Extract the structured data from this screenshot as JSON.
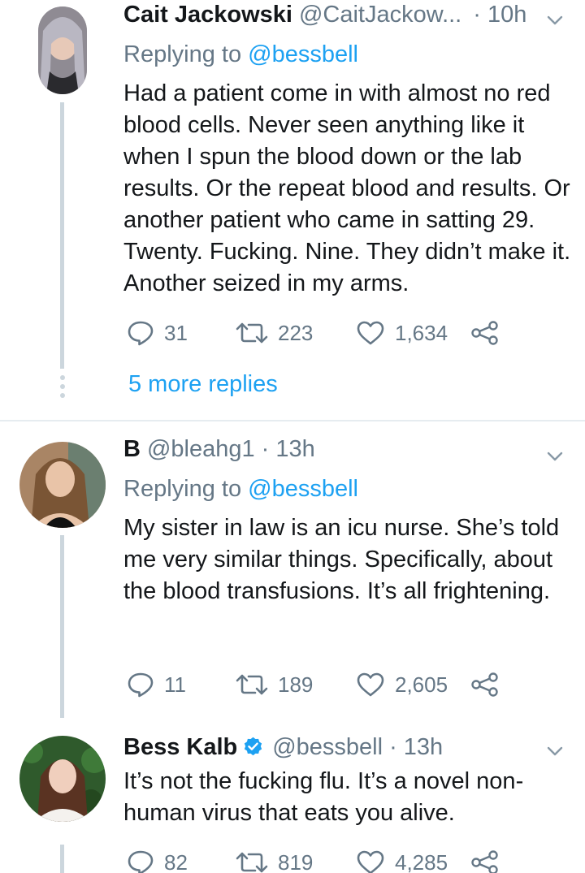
{
  "colors": {
    "accent": "#1da1f2",
    "muted": "#657786",
    "text": "#14171a",
    "line": "#ccd6dd"
  },
  "tweets": [
    {
      "name": "Cait Jackowski",
      "handle": "@CaitJackow...",
      "time": "· 10h",
      "verified": false,
      "replying_label": "Replying to",
      "replying_to": "@bessbell",
      "text": "Had a patient come in with almost no red blood cells. Never seen anything like it when I spun the blood down or the lab results. Or the repeat blood and results. Or another patient who came in satting 29. Twenty. Fucking. Nine. They didn’t make it. Another seized in my arms.",
      "replies": "31",
      "retweets": "223",
      "likes": "1,634",
      "more_replies": "5 more replies"
    },
    {
      "name": "B",
      "handle": "@bleahg1",
      "time": "· 13h",
      "verified": false,
      "replying_label": "Replying to",
      "replying_to": "@bessbell",
      "text": "My sister in law is an icu nurse. She’s told me very similar things. Specifically, about the blood transfusions. It’s all frightening.",
      "replies": "11",
      "retweets": "189",
      "likes": "2,605"
    },
    {
      "name": "Bess Kalb",
      "handle": "@bessbell",
      "time": "· 13h",
      "verified": true,
      "text": "It’s not the fucking flu. It’s a novel non-human virus that eats you alive.",
      "replies": "82",
      "retweets": "819",
      "likes": "4,285"
    }
  ]
}
